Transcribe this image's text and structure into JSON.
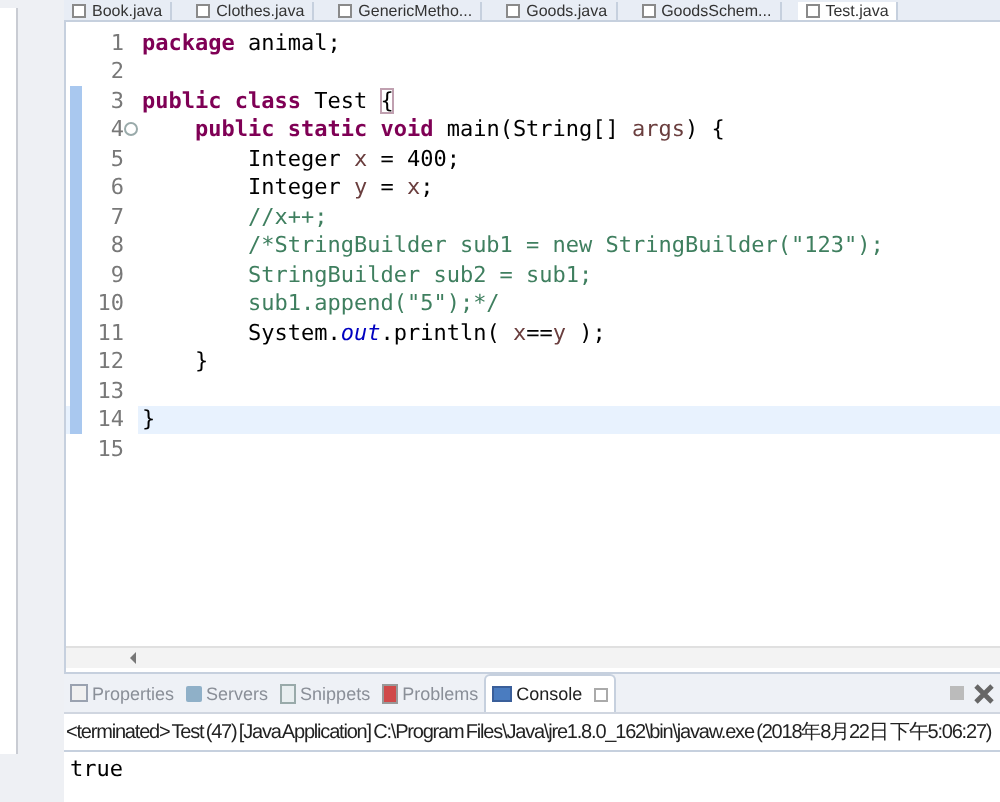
{
  "editor_tabs": [
    {
      "label": "Book.java",
      "selected": false
    },
    {
      "label": "Clothes.java",
      "selected": false
    },
    {
      "label": "GenericMetho...",
      "selected": false
    },
    {
      "label": "Goods.java",
      "selected": false
    },
    {
      "label": "GoodsSchem...",
      "selected": false
    },
    {
      "label": "Test.java",
      "selected": true
    }
  ],
  "editor": {
    "lines": [
      {
        "number": "1",
        "in_range": false,
        "current": false,
        "foldable": false,
        "tokens": [
          {
            "kind": "keyword",
            "text": "package"
          },
          {
            "kind": "plain",
            "text": " animal;"
          }
        ]
      },
      {
        "number": "2",
        "in_range": false,
        "current": false,
        "foldable": false
      },
      {
        "number": "3",
        "in_range": true,
        "current": false,
        "foldable": false,
        "tokens": [
          {
            "kind": "keyword",
            "text": "public class"
          },
          {
            "kind": "plain",
            "text": " Test "
          },
          {
            "kind": "bracket_match",
            "text": "{"
          }
        ]
      },
      {
        "number": "4",
        "in_range": true,
        "current": false,
        "foldable": true,
        "tokens": [
          {
            "kind": "keyword",
            "text": "    public static void"
          },
          {
            "kind": "plain",
            "text": " main(String[] "
          },
          {
            "kind": "param",
            "text": "args"
          },
          {
            "kind": "plain",
            "text": ") {"
          }
        ]
      },
      {
        "number": "5",
        "in_range": true,
        "current": false,
        "foldable": false,
        "tokens": [
          {
            "kind": "plain",
            "text": "        Integer "
          },
          {
            "kind": "param",
            "text": "x"
          },
          {
            "kind": "plain",
            "text": " = 400;"
          }
        ]
      },
      {
        "number": "6",
        "in_range": true,
        "current": false,
        "foldable": false,
        "tokens": [
          {
            "kind": "plain",
            "text": "        Integer "
          },
          {
            "kind": "param",
            "text": "y"
          },
          {
            "kind": "plain",
            "text": " = "
          },
          {
            "kind": "param",
            "text": "x"
          },
          {
            "kind": "plain",
            "text": ";"
          }
        ]
      },
      {
        "number": "7",
        "in_range": true,
        "current": false,
        "foldable": false,
        "tokens": [
          {
            "kind": "comment",
            "text": "        //x++;"
          }
        ]
      },
      {
        "number": "8",
        "in_range": true,
        "current": false,
        "foldable": false,
        "tokens": [
          {
            "kind": "comment",
            "text": "        /*StringBuilder sub1 = new StringBuilder(\"123\");"
          }
        ]
      },
      {
        "number": "9",
        "in_range": true,
        "current": false,
        "foldable": false,
        "tokens": [
          {
            "kind": "comment",
            "text": "        StringBuilder sub2 = sub1;"
          }
        ]
      },
      {
        "number": "10",
        "in_range": true,
        "current": false,
        "foldable": false,
        "tokens": [
          {
            "kind": "comment",
            "text": "        sub1.append(\"5\");*/"
          }
        ]
      },
      {
        "number": "11",
        "in_range": true,
        "current": false,
        "foldable": false,
        "tokens": [
          {
            "kind": "plain",
            "text": "        System."
          },
          {
            "kind": "field",
            "text": "out"
          },
          {
            "kind": "plain",
            "text": ".println( "
          },
          {
            "kind": "param",
            "text": "x"
          },
          {
            "kind": "plain",
            "text": "=="
          },
          {
            "kind": "param",
            "text": "y"
          },
          {
            "kind": "plain",
            "text": " );"
          }
        ]
      },
      {
        "number": "12",
        "in_range": true,
        "current": false,
        "foldable": false,
        "tokens": [
          {
            "kind": "plain",
            "text": "    }"
          }
        ]
      },
      {
        "number": "13",
        "in_range": true,
        "current": false,
        "foldable": false
      },
      {
        "number": "14",
        "in_range": true,
        "current": true,
        "foldable": false,
        "tokens": [
          {
            "kind": "plain",
            "text": "}"
          }
        ]
      },
      {
        "number": "15",
        "in_range": false,
        "current": false,
        "foldable": false
      }
    ]
  },
  "bottom_tabs": [
    {
      "label": "Properties",
      "kind": "properties",
      "selected": false
    },
    {
      "label": "Servers",
      "kind": "servers",
      "selected": false
    },
    {
      "label": "Snippets",
      "kind": "snippets",
      "selected": false
    },
    {
      "label": "Problems",
      "kind": "problems",
      "selected": false
    },
    {
      "label": "Console",
      "kind": "console",
      "selected": true
    }
  ],
  "console": {
    "header": "<terminated> Test (47) [Java Application] C:\\Program Files\\Java\\jre1.8.0_162\\bin\\javaw.exe (2018年8月22日 下午5:06:27)",
    "output": "true"
  }
}
